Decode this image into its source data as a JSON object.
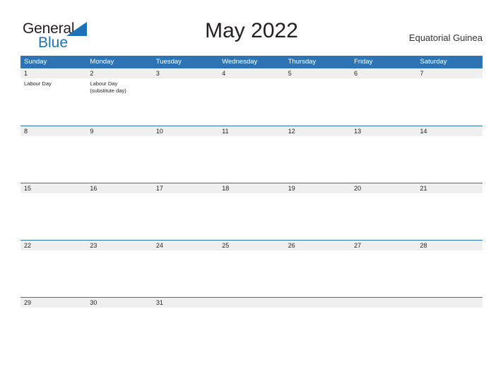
{
  "brand": {
    "name_part1": "General",
    "name_part2": "Blue",
    "triangle_icon": "brand-triangle-icon",
    "colors": {
      "blue": "#1d71b8",
      "dark": "#231f20"
    }
  },
  "header": {
    "title": "May 2022",
    "locale": "Equatorial Guinea"
  },
  "calendar": {
    "colors": {
      "header_bar": "#2e74b5",
      "date_strip": "#efefef",
      "divider": "#2e74b5"
    },
    "weekdays": [
      "Sunday",
      "Monday",
      "Tuesday",
      "Wednesday",
      "Thursday",
      "Friday",
      "Saturday"
    ],
    "weeks": [
      {
        "days": [
          {
            "date": "1",
            "event": "Labour Day"
          },
          {
            "date": "2",
            "event": "Labour Day\n(substitute day)"
          },
          {
            "date": "3",
            "event": ""
          },
          {
            "date": "4",
            "event": ""
          },
          {
            "date": "5",
            "event": ""
          },
          {
            "date": "6",
            "event": ""
          },
          {
            "date": "7",
            "event": ""
          }
        ]
      },
      {
        "days": [
          {
            "date": "8",
            "event": ""
          },
          {
            "date": "9",
            "event": ""
          },
          {
            "date": "10",
            "event": ""
          },
          {
            "date": "11",
            "event": ""
          },
          {
            "date": "12",
            "event": ""
          },
          {
            "date": "13",
            "event": ""
          },
          {
            "date": "14",
            "event": ""
          }
        ]
      },
      {
        "days": [
          {
            "date": "15",
            "event": ""
          },
          {
            "date": "16",
            "event": ""
          },
          {
            "date": "17",
            "event": ""
          },
          {
            "date": "18",
            "event": ""
          },
          {
            "date": "19",
            "event": ""
          },
          {
            "date": "20",
            "event": ""
          },
          {
            "date": "21",
            "event": ""
          }
        ]
      },
      {
        "days": [
          {
            "date": "22",
            "event": ""
          },
          {
            "date": "23",
            "event": ""
          },
          {
            "date": "24",
            "event": ""
          },
          {
            "date": "25",
            "event": ""
          },
          {
            "date": "26",
            "event": ""
          },
          {
            "date": "27",
            "event": ""
          },
          {
            "date": "28",
            "event": ""
          }
        ]
      },
      {
        "days": [
          {
            "date": "29",
            "event": ""
          },
          {
            "date": "30",
            "event": ""
          },
          {
            "date": "31",
            "event": ""
          },
          {
            "date": "",
            "event": ""
          },
          {
            "date": "",
            "event": ""
          },
          {
            "date": "",
            "event": ""
          },
          {
            "date": "",
            "event": ""
          }
        ]
      }
    ]
  }
}
